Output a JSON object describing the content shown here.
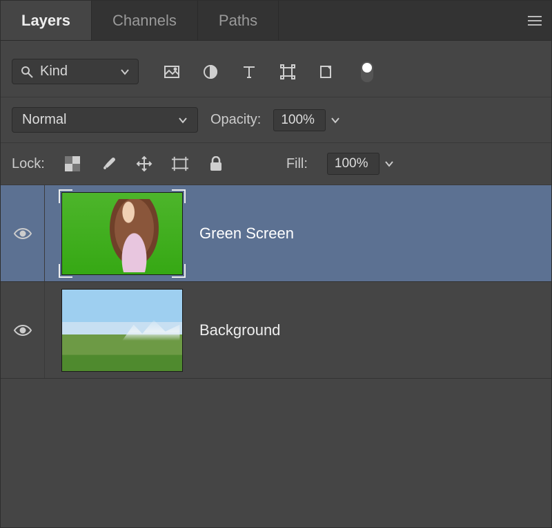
{
  "tabs": [
    {
      "label": "Layers",
      "active": true
    },
    {
      "label": "Channels",
      "active": false
    },
    {
      "label": "Paths",
      "active": false
    }
  ],
  "filter": {
    "kind_label": "Kind"
  },
  "blend": {
    "mode": "Normal",
    "opacity_label": "Opacity:",
    "opacity_value": "100%"
  },
  "lock": {
    "label": "Lock:",
    "fill_label": "Fill:",
    "fill_value": "100%"
  },
  "layers": [
    {
      "name": "Green Screen",
      "visible": true,
      "selected": true,
      "thumb": "green"
    },
    {
      "name": "Background",
      "visible": true,
      "selected": false,
      "thumb": "bg"
    }
  ]
}
